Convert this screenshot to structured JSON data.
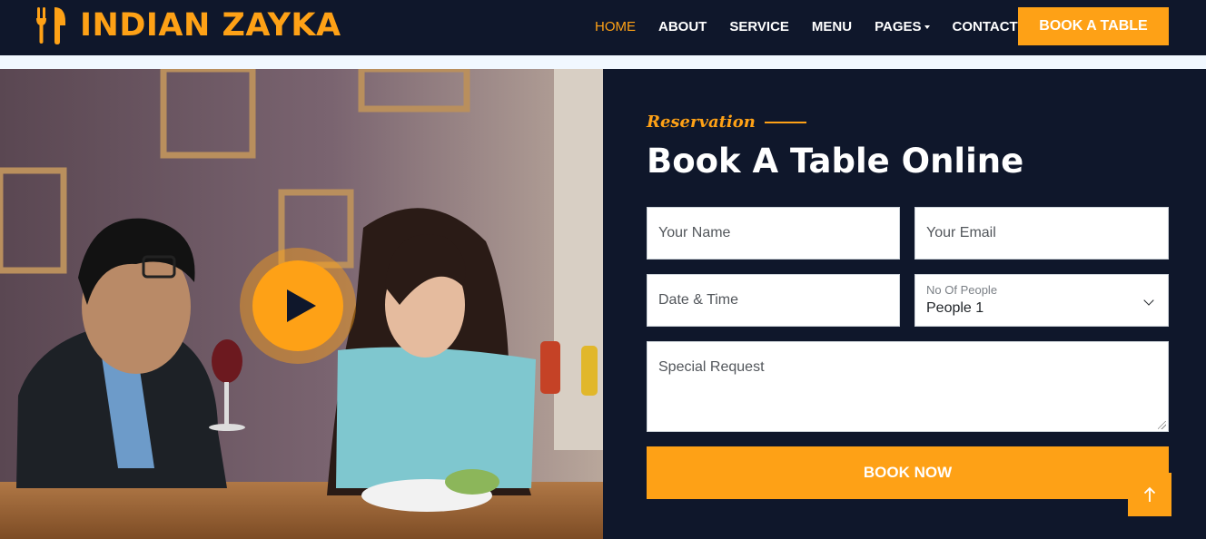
{
  "brand": {
    "name": "INDIAN ZAYKA",
    "icon": "utensils-icon",
    "color": "#fea116"
  },
  "nav": {
    "items": [
      {
        "label": "HOME",
        "active": true
      },
      {
        "label": "ABOUT",
        "active": false
      },
      {
        "label": "SERVICE",
        "active": false
      },
      {
        "label": "MENU",
        "active": false
      },
      {
        "label": "PAGES",
        "active": false,
        "dropdown": true
      },
      {
        "label": "CONTACT",
        "active": false
      }
    ],
    "cta_label": "BOOK A TABLE"
  },
  "video": {
    "play_icon": "play-icon",
    "image": "restaurant-couple-dining-photo"
  },
  "reservation": {
    "eyebrow": "Reservation",
    "title": "Book A Table Online",
    "fields": {
      "name_placeholder": "Your Name",
      "email_placeholder": "Your Email",
      "datetime_placeholder": "Date & Time",
      "people_label": "No Of People",
      "people_value": "People 1",
      "request_placeholder": "Special Request"
    },
    "submit_label": "BOOK NOW"
  },
  "back_to_top_icon": "arrow-up-icon",
  "colors": {
    "accent": "#fea116",
    "dark": "#0f172b",
    "light": "#f1f8ff"
  }
}
